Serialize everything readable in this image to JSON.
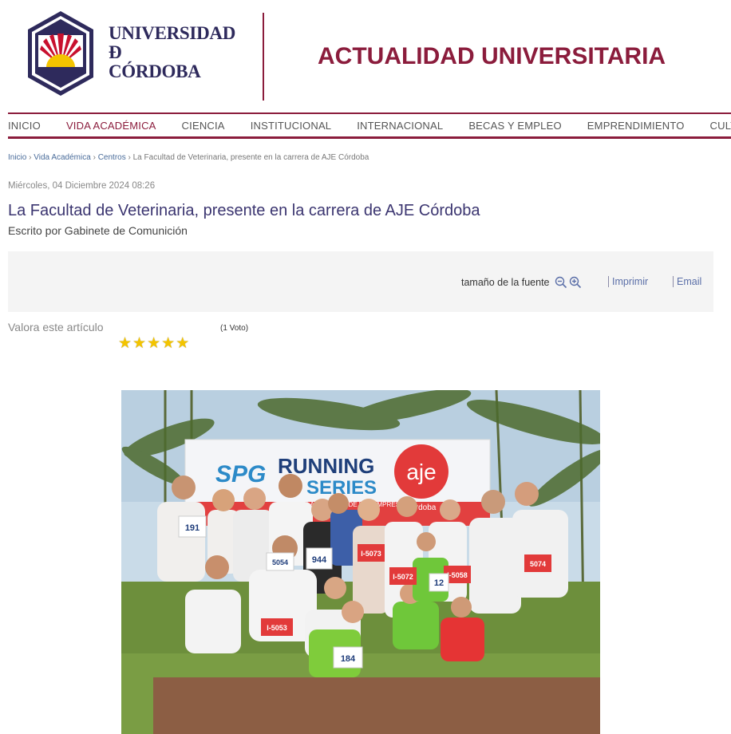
{
  "brand": {
    "logo_line1": "UNIVERSIDAD",
    "logo_line2": "Ð",
    "logo_line3": "CÓRDOBA",
    "site_title": "ACTUALIDAD UNIVERSITARIA",
    "primary_color": "#8b1c3c",
    "navy_color": "#2e2a5c"
  },
  "nav": {
    "items": [
      "INICIO",
      "VIDA ACADÉMICA",
      "CIENCIA",
      "INSTITUCIONAL",
      "INTERNACIONAL",
      "BECAS Y EMPLEO",
      "EMPRENDIMIENTO",
      "CULTURA"
    ]
  },
  "breadcrumb": {
    "items": [
      "Inicio",
      "Vida Académica",
      "Centros",
      "La Facultad de Veterinaria, presente en la carrera de AJE Córdoba"
    ],
    "separator": "›"
  },
  "article": {
    "date": "Miércoles, 04 Diciembre 2024 08:26",
    "title": "La Facultad de Veterinaria, presente en la carrera de AJE Córdoba",
    "author": "Escrito por Gabinete de Comunición"
  },
  "toolbar": {
    "font_size_label": "tamaño de la fuente",
    "zoom_out_icon": "zoom-out-icon",
    "zoom_in_icon": "zoom-in-icon",
    "print_label": "Imprimir",
    "email_label": "Email"
  },
  "rating": {
    "label": "Valora este artículo",
    "stars": 5,
    "rating_value": 5,
    "votes": "(1 Voto)"
  },
  "photo": {
    "banner_brand": "SPG",
    "banner_line1": "RUNNING",
    "banner_line2": "SERIES",
    "banner_sub": "LA CARRERA DE LAS EMPRESAS",
    "banner_logo": "aje",
    "banner_logo_sub": "Córdoba",
    "bibs": [
      "191",
      "5054",
      "944",
      "I-5073",
      "I-5072",
      "I-5058",
      "5074",
      "I-5053",
      "184",
      "12"
    ]
  }
}
